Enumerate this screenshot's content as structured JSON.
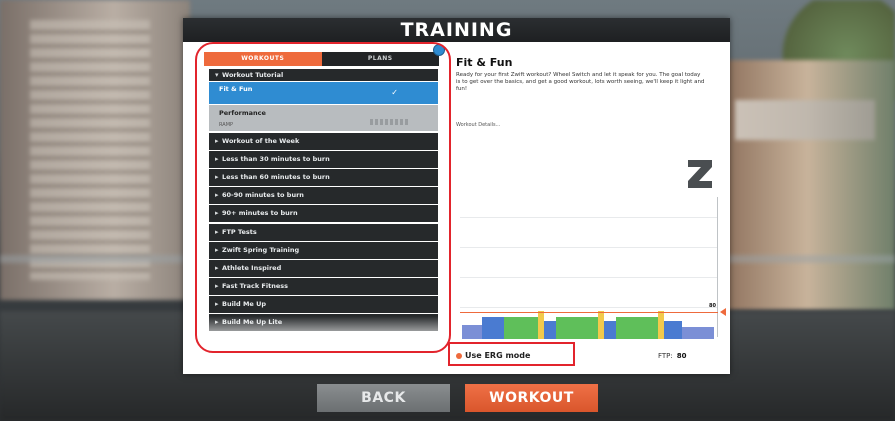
{
  "screen": {
    "title": "TRAINING"
  },
  "tabs": [
    {
      "label": "WORKOUTS",
      "active": true
    },
    {
      "label": "PLANS",
      "active": false
    }
  ],
  "workout_list": {
    "header": "Workout Tutorial",
    "selected": {
      "label": "Fit & Fun"
    },
    "performance": {
      "label": "Performance",
      "sub": "RAMP"
    },
    "categories": [
      "Workout of the Week",
      "Less than 30 minutes to burn",
      "Less than 60 minutes to burn",
      "60-90 minutes to burn",
      "90+ minutes to burn",
      "FTP Tests",
      "Zwift Spring Training",
      "Athlete Inspired",
      "Fast Track Fitness",
      "Build Me Up",
      "Build Me Up Lite"
    ]
  },
  "detail": {
    "title": "Fit & Fun",
    "description": "Ready for your first Zwift workout? Wheel Switch and let it speak for you. The goal today is to get over the basics, and get a good workout, lots worth seeing, we'll keep it light and fun!",
    "meta": "Workout Details..."
  },
  "controls": {
    "erg_label": "Use ERG mode",
    "ftp_label": "FTP:",
    "ftp_value": "80"
  },
  "buttons": {
    "back": "BACK",
    "workout": "WORKOUT"
  },
  "colors": {
    "accent": "#ee6a3c",
    "selected": "#2f8cd2",
    "annotation": "#e2242c"
  }
}
